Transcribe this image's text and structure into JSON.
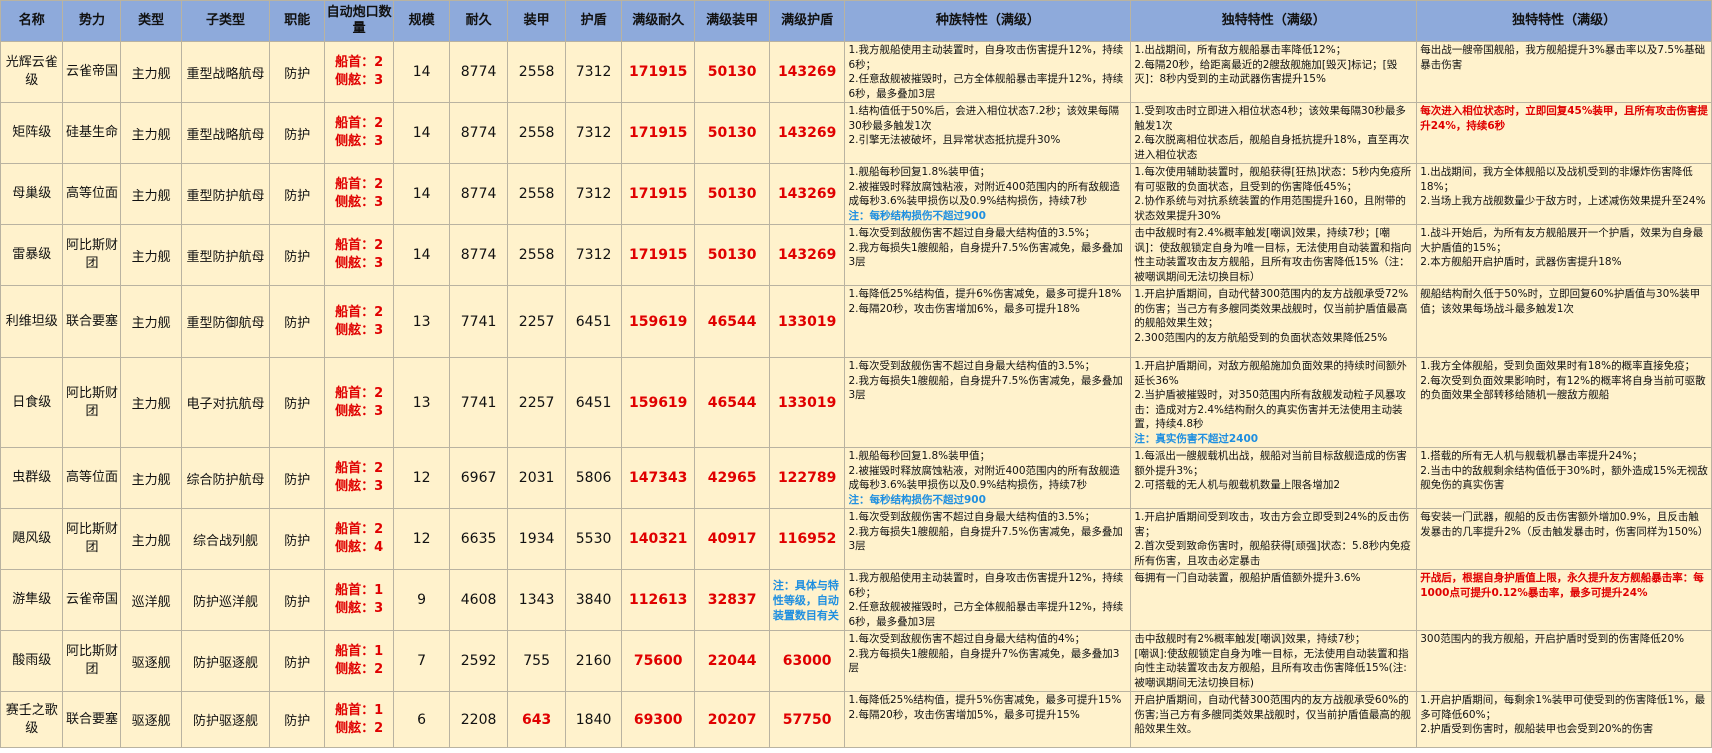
{
  "headers": [
    "名称",
    "势力",
    "类型",
    "子类型",
    "职能",
    "自动炮口数量",
    "规模",
    "耐久",
    "装甲",
    "护盾",
    "满级耐久",
    "满级装甲",
    "满级护盾",
    "种族特性（满级）",
    "独特特性（满级）",
    "独特特性（满级）"
  ],
  "rows": [
    {
      "name": "光辉云雀级",
      "faction": "云雀帝国",
      "type": "主力舰",
      "subtype": "重型战略航母",
      "role": "防护",
      "guns_bow": "船首：2",
      "guns_side": "侧舷：3",
      "scale": "14",
      "hp": "8774",
      "armor": "2558",
      "shield": "7312",
      "max_hp": "171915",
      "max_armor": "50130",
      "max_shield": "143269",
      "race_trait": [
        "1.我方舰船使用主动装置时，自身攻击伤害提升12%，持续6秒；",
        "2.任意敌舰被摧毁时，己方全体舰船暴击率提升12%，持续6秒，最多叠加3层"
      ],
      "unique1": [
        "1.出战期间，所有敌方舰船暴击率降低12%；",
        "2.每隔20秒，给距离最近的2艘敌舰施加[毁灭]标记；[毁灭]：8秒内受到的主动武器伤害提升15%"
      ],
      "unique2": [
        "每出战一艘帝国舰船，我方舰船提升3%暴击率以及7.5%基础暴击伤害"
      ]
    },
    {
      "name": "矩阵级",
      "faction": "硅基生命",
      "type": "主力舰",
      "subtype": "重型战略航母",
      "role": "防护",
      "guns_bow": "船首：2",
      "guns_side": "侧舷：3",
      "scale": "14",
      "hp": "8774",
      "armor": "2558",
      "shield": "7312",
      "max_hp": "171915",
      "max_armor": "50130",
      "max_shield": "143269",
      "race_trait": [
        "1.结构值低于50%后，会进入相位状态7.2秒；该效果每隔30秒最多触发1次",
        "2.引擎无法被破坏，且异常状态抵抗提升30%"
      ],
      "unique1": [
        "1.受到攻击时立即进入相位状态4秒；该效果每隔30秒最多触发1次",
        "2.每次脱离相位状态后，舰船自身抵抗提升18%，直至再次进入相位状态"
      ],
      "unique2": [
        "每次进入相位状态时，立即回复45%装甲，且所有攻击伤害提升24%，持续6秒"
      ]
    },
    {
      "name": "母巢级",
      "faction": "高等位面",
      "type": "主力舰",
      "subtype": "重型防护航母",
      "role": "防护",
      "guns_bow": "船首：2",
      "guns_side": "侧舷：3",
      "scale": "14",
      "hp": "8774",
      "armor": "2558",
      "shield": "7312",
      "max_hp": "171915",
      "max_armor": "50130",
      "max_shield": "143269",
      "race_trait": [
        "1.舰船每秒回复1.8%装甲值；",
        "2.被摧毁时释放腐蚀粘液，对附近400范围内的所有敌舰造成每秒3.6%装甲损伤以及0.9%结构损伤，持续7秒"
      ],
      "race_note": "注：每秒结构损伤不超过900",
      "unique1": [
        "1.每次使用辅助装置时，舰船获得[狂热]状态：5秒内免疫所有可驱散的负面状态，且受到的伤害降低45%；",
        "2.协作系统与对抗系统装置的作用范围提升160，且附带的状态效果提升30%"
      ],
      "unique2": [
        "1.出战期间，我方全体舰船以及战机受到的非爆炸伤害降低18%；",
        "2.当场上我方战舰数量少于敌方时，上述减伤效果提升至24%"
      ]
    },
    {
      "name": "雷暴级",
      "faction": "阿比斯财团",
      "type": "主力舰",
      "subtype": "重型防护航母",
      "role": "防护",
      "guns_bow": "船首：2",
      "guns_side": "侧舷：3",
      "scale": "14",
      "hp": "8774",
      "armor": "2558",
      "shield": "7312",
      "max_hp": "171915",
      "max_armor": "50130",
      "max_shield": "143269",
      "race_trait": [
        "1.每次受到敌舰伤害不超过自身最大结构值的3.5%；",
        "2.我方每损失1艘舰船，自身提升7.5%伤害减免，最多叠加3层"
      ],
      "unique1": [
        "击中敌舰时有2.4%概率触发[嘲讽]效果，持续7秒；[嘲讽]：使敌舰锁定自身为唯一目标，无法使用自动装置和指向性主动装置攻击友方舰船，且所有攻击伤害降低15%（注：被嘲讽期间无法切换目标）"
      ],
      "unique2": [
        "1.战斗开始后，为所有友方舰船展开一个护盾，效果为自身最大护盾值的15%；",
        "2.本方舰船开启护盾时，武器伤害提升18%"
      ]
    },
    {
      "name": "利维坦级",
      "faction": "联合要塞",
      "type": "主力舰",
      "subtype": "重型防御航母",
      "role": "防护",
      "guns_bow": "船首：2",
      "guns_side": "侧舷：3",
      "scale": "13",
      "hp": "7741",
      "armor": "2257",
      "shield": "6451",
      "max_hp": "159619",
      "max_armor": "46544",
      "max_shield": "133019",
      "race_trait": [
        "1.每降低25%结构值，提升6%伤害减免，最多可提升18%",
        "2.每隔20秒，攻击伤害增加6%，最多可提升18%"
      ],
      "unique1": [
        "1.开启护盾期间，自动代替300范围内的友方战舰承受72%的伤害；当己方有多艘同类效果战舰时，仅当前护盾值最高的舰船效果生效；",
        "2.300范围内的友方航船受到的负面状态效果降低25%"
      ],
      "unique2": [
        "舰船结构耐久低于50%时，立即回复60%护盾值与30%装甲值；该效果每场战斗最多触发1次"
      ]
    },
    {
      "name": "日食级",
      "faction": "阿比斯财团",
      "type": "主力舰",
      "subtype": "电子对抗航母",
      "role": "防护",
      "guns_bow": "船首：2",
      "guns_side": "侧舷：3",
      "scale": "13",
      "hp": "7741",
      "armor": "2257",
      "shield": "6451",
      "max_hp": "159619",
      "max_armor": "46544",
      "max_shield": "133019",
      "race_trait": [
        "1.每次受到敌舰伤害不超过自身最大结构值的3.5%；",
        "2.我方每损失1艘舰船，自身提升7.5%伤害减免，最多叠加3层"
      ],
      "unique1": [
        "1.开启护盾期间，对敌方舰船施加负面效果的持续时间额外延长36%",
        "2.当护盾被摧毁时，对350范围内所有敌舰发动粒子风暴攻击：造成对方2.4%结构耐久的真实伤害并无法使用主动装置，持续4.8秒"
      ],
      "unique1_note": "注：真实伤害不超过2400",
      "unique2": [
        "1.我方全体舰船，受到负面效果时有18%的概率直接免疫；",
        "2.每次受到负面效果影响时，有12%的概率将自身当前可驱散的负面效果全部转移给随机一艘敌方舰船"
      ]
    },
    {
      "name": "虫群级",
      "faction": "高等位面",
      "type": "主力舰",
      "subtype": "综合防护航母",
      "role": "防护",
      "guns_bow": "船首：2",
      "guns_side": "侧舷：3",
      "scale": "12",
      "hp": "6967",
      "armor": "2031",
      "shield": "5806",
      "max_hp": "147343",
      "max_armor": "42965",
      "max_shield": "122789",
      "race_trait": [
        "1.舰船每秒回复1.8%装甲值；",
        "2.被摧毁时释放腐蚀粘液，对附近400范围内的所有敌舰造成每秒3.6%装甲损伤以及0.9%结构损伤，持续7秒"
      ],
      "race_note": "注：每秒结构损伤不超过900",
      "unique1": [
        "1.每派出一艘舰载机出战，舰船对当前目标敌舰造成的伤害额外提升3%；",
        "2.可搭载的无人机与舰载机数量上限各增加2"
      ],
      "unique2": [
        "1.搭载的所有无人机与舰载机暴击率提升24%；",
        "2.当击中的敌舰剩余结构值低于30%时，额外造成15%无视敌舰免伤的真实伤害"
      ]
    },
    {
      "name": "飓风级",
      "faction": "阿比斯财团",
      "type": "主力舰",
      "subtype": "综合战列舰",
      "role": "防护",
      "guns_bow": "船首：2",
      "guns_side": "侧舷：4",
      "scale": "12",
      "hp": "6635",
      "armor": "1934",
      "shield": "5530",
      "max_hp": "140321",
      "max_armor": "40917",
      "max_shield": "116952",
      "race_trait": [
        "1.每次受到敌舰伤害不超过自身最大结构值的3.5%；",
        "2.我方每损失1艘舰船，自身提升7.5%伤害减免，最多叠加3层"
      ],
      "unique1": [
        "1.开启护盾期间受到攻击，攻击方会立即受到24%的反击伤害；",
        "2.首次受到致命伤害时，舰船获得[顽强]状态：5.8秒内免疫所有伤害，且攻击必定暴击"
      ],
      "unique2": [
        "每安装一门武器，舰船的反击伤害额外增加0.9%，且反击触发暴击的几率提升2%（反击触发暴击时，伤害同样为150%）"
      ]
    },
    {
      "name": "游隼级",
      "faction": "云雀帝国",
      "type": "巡洋舰",
      "subtype": "防护巡洋舰",
      "role": "防护",
      "guns_bow": "船首：1",
      "guns_side": "侧舷：3",
      "scale": "9",
      "hp": "4608",
      "armor": "1343",
      "shield": "3840",
      "max_hp": "112613",
      "max_armor": "32837",
      "max_shield_note": "注：具体与特性等级，自动装置数目有关",
      "race_trait": [
        "1.我方舰船使用主动装置时，自身攻击伤害提升12%，持续6秒；",
        "2.任意敌舰被摧毁时，己方全体舰船暴击率提升12%，持续6秒，最多叠加3层"
      ],
      "unique1": [
        "每拥有一门自动装置，舰船护盾值额外提升3.6%"
      ],
      "unique2": [
        "开战后，根据自身护盾值上限，永久提升友方舰船暴击率：每1000点可提升0.12%暴击率，最多可提升24%"
      ]
    },
    {
      "name": "酸雨级",
      "faction": "阿比斯财团",
      "type": "驱逐舰",
      "subtype": "防护驱逐舰",
      "role": "防护",
      "guns_bow": "船首：1",
      "guns_side": "侧舷：2",
      "scale": "7",
      "hp": "2592",
      "armor": "755",
      "shield": "2160",
      "max_hp": "75600",
      "max_armor": "22044",
      "max_shield": "63000",
      "race_trait": [
        "1.每次受到敌舰伤害不超过自身最大结构值的4%；",
        "2.我方每损失1艘舰船，自身提升7%伤害减免，最多叠加3层"
      ],
      "unique1": [
        "击中敌舰时有2%概率触发[嘲讽]效果，持续7秒；",
        "[嘲讽]:使敌舰锁定自身为唯一目标，无法使用自动装置和指向性主动装置攻击友方舰船，且所有攻击伤害降低15%(注:被嘲讽期间无法切换目标)"
      ],
      "unique2": [
        "300范围内的我方舰船，开启护盾时受到的伤害降低20%"
      ]
    },
    {
      "name": "赛壬之歌级",
      "faction": "联合要塞",
      "type": "驱逐舰",
      "subtype": "防护驱逐舰",
      "role": "防护",
      "guns_bow": "船首：1",
      "guns_side": "侧舷：2",
      "scale": "6",
      "hp": "2208",
      "armor": "643",
      "shield": "1840",
      "max_hp": "69300",
      "max_armor": "20207",
      "max_shield": "57750",
      "race_trait": [
        "1.每降低25%结构值，提升5%伤害减免，最多可提升15%",
        "2.每隔20秒，攻击伤害增加5%，最多可提升15%"
      ],
      "unique1": [
        "开启护盾期间，自动代替300范围内的友方战舰承受60%的伤害;当己方有多艘同类效果战舰时，仅当前护盾值最高的舰船效果生效。"
      ],
      "unique2": [
        "1.开启护盾期间，每剩余1%装甲可使受到的伤害降低1%，最多可降低60%；",
        "2.护盾受到伤害时，舰船装甲也会受到20%的伤害"
      ]
    }
  ]
}
